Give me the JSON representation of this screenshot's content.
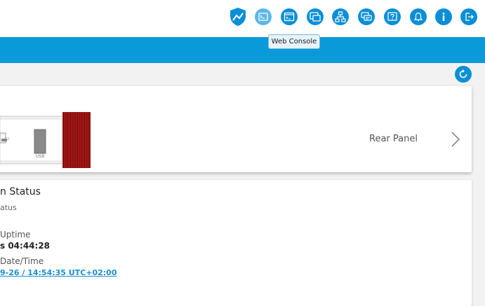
{
  "toolbar": {
    "icons": [
      {
        "name": "shield-icon"
      },
      {
        "name": "terminal-icon"
      },
      {
        "name": "web-console-icon"
      },
      {
        "name": "windows-icon"
      },
      {
        "name": "network-icon"
      },
      {
        "name": "chat-icon"
      },
      {
        "name": "help-icon"
      },
      {
        "name": "bell-icon"
      },
      {
        "name": "info-icon"
      },
      {
        "name": "logout-icon"
      }
    ],
    "tooltip": "Web Console"
  },
  "rear_panel": {
    "label": "Rear Panel",
    "port_labels": [
      "USB"
    ]
  },
  "system_status": {
    "title": "n Status",
    "subtitle": "atus",
    "uptime_label": "Uptime",
    "uptime_value": "s 04:44:28",
    "datetime_label": "Date/Time",
    "datetime_value": "9-26 / 14:54:35 UTC+02:00"
  },
  "colors": {
    "accent": "#0a9ad9",
    "icon_blue": "#0a8fd6",
    "link": "#1a8fd0",
    "device_red": "#b31a17"
  }
}
